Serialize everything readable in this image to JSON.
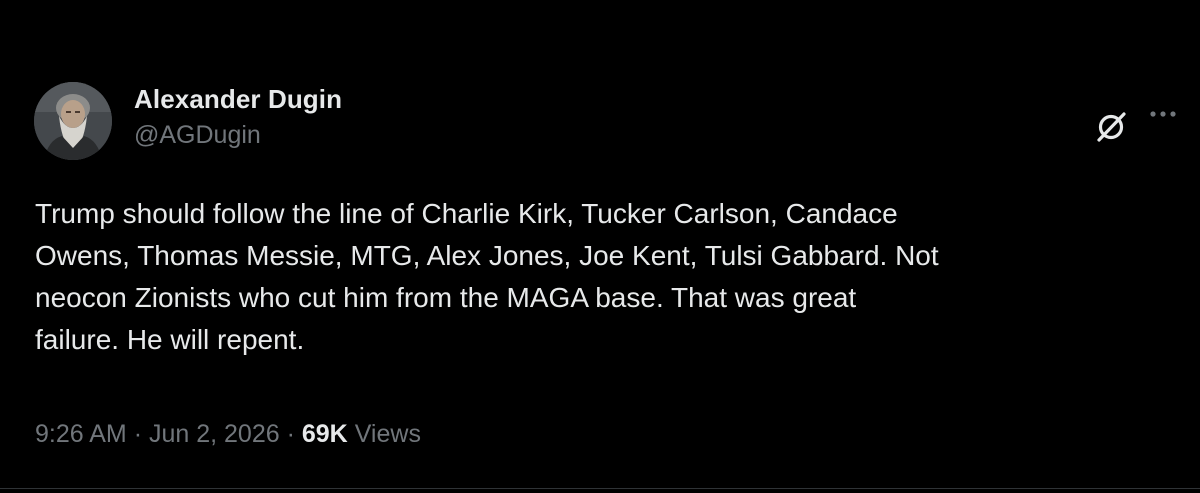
{
  "tweet": {
    "author": {
      "display_name": "Alexander Dugin",
      "handle": "@AGDugin"
    },
    "text": "Trump should follow the line of Charlie Kirk, Tucker Carlson, Candace\nOwens, Thomas Messie, MTG, Alex Jones, Joe Kent, Tulsi Gabbard. Not\nneocon Zionists who cut him from the MAGA base. That was great\nfailure. He will repent.",
    "time": "9:26 AM",
    "separator": "·",
    "date": "Jun 2, 2026",
    "views_count": "69K",
    "views_label": "Views"
  },
  "icons": {
    "grok": "grok-icon",
    "more": "more-icon"
  },
  "colors": {
    "background": "#000000",
    "primary_text": "#e7e9ea",
    "secondary_text": "#71767b",
    "divider": "#2f3336"
  }
}
